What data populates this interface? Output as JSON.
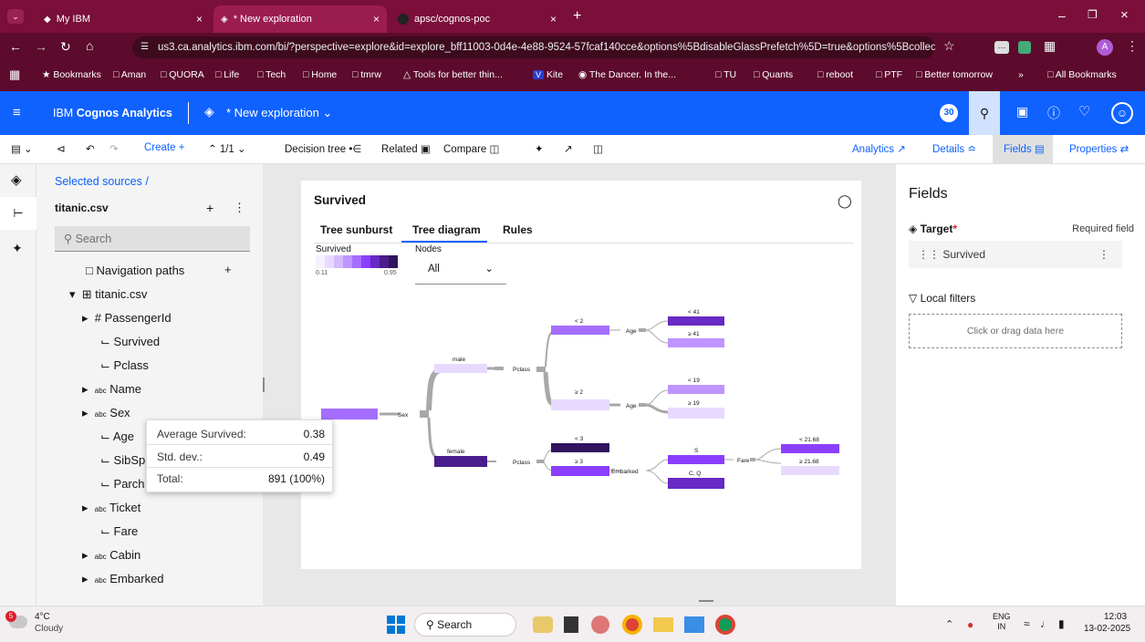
{
  "browser": {
    "tabs": [
      {
        "label": "My IBM"
      },
      {
        "label": "* New exploration"
      },
      {
        "label": "apsc/cognos-poc"
      }
    ],
    "url": "us3.ca.analytics.ibm.com/bi/?perspective=explore&id=explore_bff11003-0d4e-4e88-9524-57fcaf140cce&options%5BdisableGlassPrefetch%5D=true&options%5Bcollections%5...",
    "bookmarks": [
      "Bookmarks",
      "Aman",
      "QUORA",
      "Life",
      "Tech",
      "Home",
      "tmrw",
      "Tools for better thin...",
      "Kite",
      "The Dancer. In the...",
      "TU",
      "Quants",
      "reboot",
      "PTF",
      "Better tomorrow",
      "All Bookmarks"
    ]
  },
  "app": {
    "brand_prefix": "IBM ",
    "brand_bold": "Cognos Analytics",
    "exploration": "* New exploration",
    "notif_count": "30"
  },
  "toolbar": {
    "create": "Create",
    "page": "1/1",
    "decision_tree": "Decision tree",
    "related": "Related",
    "compare": "Compare",
    "analytics": "Analytics",
    "details": "Details",
    "fields": "Fields",
    "properties": "Properties"
  },
  "left": {
    "breadcrumb": "Selected sources /",
    "source": "titanic.csv",
    "search_placeholder": "Search",
    "nav_paths": "Navigation paths",
    "table": "titanic.csv",
    "fields": [
      {
        "type": "#",
        "name": "PassengerId"
      },
      {
        "type": "",
        "name": "Survived"
      },
      {
        "type": "",
        "name": "Pclass"
      },
      {
        "type": "abc",
        "name": "Name"
      },
      {
        "type": "abc",
        "name": "Sex"
      },
      {
        "type": "",
        "name": "Age"
      },
      {
        "type": "",
        "name": "SibSp"
      },
      {
        "type": "",
        "name": "Parch"
      },
      {
        "type": "abc",
        "name": "Ticket"
      },
      {
        "type": "",
        "name": "Fare"
      },
      {
        "type": "abc",
        "name": "Cabin"
      },
      {
        "type": "abc",
        "name": "Embarked"
      }
    ]
  },
  "tooltip": {
    "avg_label": "Average Survived:",
    "avg_value": "0.38",
    "std_label": "Std. dev.:",
    "std_value": "0.49",
    "total_label": "Total:",
    "total_value": "891 (100%)"
  },
  "card": {
    "title": "Survived",
    "tabs": [
      "Tree sunburst",
      "Tree diagram",
      "Rules"
    ],
    "legend_label": "Survived",
    "legend_min": "0.11",
    "legend_max": "0.95",
    "nodes_label": "Nodes",
    "nodes_value": "All"
  },
  "tree": {
    "labels": {
      "sex": "Sex",
      "male": "male",
      "female": "female",
      "pclass1": "Pclass",
      "pclass2": "Pclass",
      "lt2": "< 2",
      "ge2": "≥ 2",
      "lt3": "< 3",
      "ge3": "≥ 3",
      "age1": "Age",
      "age2": "Age",
      "lt41": "< 41",
      "ge41": "≥ 41",
      "lt19": "< 19",
      "ge19": "≥ 19",
      "embarked": "Embarked",
      "s": "S",
      "cq": "C, Q",
      "fare": "Fare",
      "lt2168": "< 21.68",
      "ge2168": "≥ 21.68"
    },
    "colors": {
      "root": "#a56eff",
      "male": "#e8daff",
      "female": "#491d8b",
      "lt2": "#a56eff",
      "ge2": "#e8daff",
      "lt3": "#31135e",
      "ge3": "#8a3ffc",
      "lt41": "#6929c4",
      "ge41": "#be95ff",
      "lt19": "#be95ff",
      "ge19": "#e8daff",
      "s": "#8a3ffc",
      "cq": "#6929c4",
      "lt2168": "#8a3ffc",
      "ge2168": "#e8daff"
    }
  },
  "right": {
    "title": "Fields",
    "target_label": "Target",
    "required": "Required field",
    "target_value": "Survived",
    "filters": "Local filters",
    "drop_hint": "Click or drag data here"
  },
  "taskbar": {
    "temp": "4°C",
    "weather": "Cloudy",
    "search": "Search",
    "lang1": "ENG",
    "lang2": "IN",
    "time": "12:03",
    "date": "13-02-2025",
    "weather_badge": "5"
  }
}
